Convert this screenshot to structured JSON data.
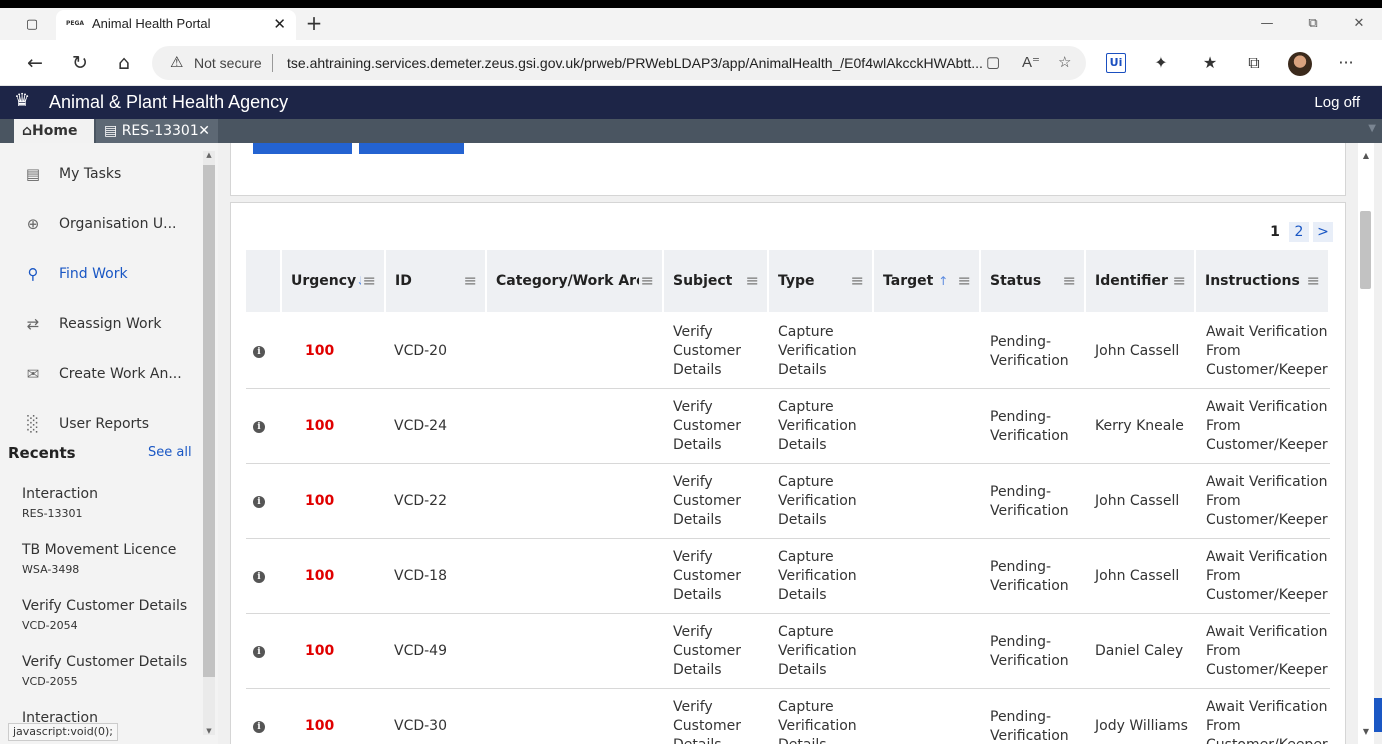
{
  "browser": {
    "tab_title": "Animal Health Portal",
    "tab_favicon": "PEGA",
    "security_label": "Not secure",
    "url": "tse.ahtraining.services.demeter.zeus.gsi.gov.uk/prweb/PRWebLDAP3/app/AnimalHealth_/E0f4wlAkcckHWAbtt...",
    "ext_label": "Ui"
  },
  "app": {
    "agency_name": "Animal & Plant Health Agency",
    "logoff_label": "Log off"
  },
  "work_tabs": {
    "home_label": "Home",
    "case_label": "RES-13301"
  },
  "sidebar": {
    "items": [
      {
        "label": "My Tasks",
        "icon": "clipboard-icon"
      },
      {
        "label": "Organisation U...",
        "icon": "globe-icon"
      },
      {
        "label": "Find Work",
        "icon": "search-icon"
      },
      {
        "label": "Reassign Work",
        "icon": "reassign-arrows-icon"
      },
      {
        "label": "Create Work An...",
        "icon": "briefcase-icon"
      },
      {
        "label": "User Reports",
        "icon": "bar-chart-icon"
      }
    ],
    "recents_title": "Recents",
    "see_all_label": "See all",
    "recents": [
      {
        "title": "Interaction",
        "id": "RES-13301"
      },
      {
        "title": "TB Movement Licence",
        "id": "WSA-3498"
      },
      {
        "title": "Verify Customer Details",
        "id": "VCD-2054"
      },
      {
        "title": "Verify Customer Details",
        "id": "VCD-2055"
      },
      {
        "title": "Interaction",
        "id": ""
      }
    ]
  },
  "status_bar_text": "javascript:void(0);",
  "pager": {
    "current": "1",
    "next_page": "2",
    "next_arrow": ">"
  },
  "table": {
    "headers": {
      "urgency": "Urgency",
      "id": "ID",
      "category": "Category/Work Area",
      "subject": "Subject",
      "type": "Type",
      "target": "Target",
      "status": "Status",
      "identifier": "Identifier",
      "instructions": "Instructions"
    },
    "rows": [
      {
        "urgency": "100",
        "id": "VCD-20",
        "subject": "Verify Customer Details",
        "type": "Capture Verification Details",
        "status": "Pending-Verification",
        "identifier": "John Cassell",
        "instructions": "Await Verification From Customer/Keeper"
      },
      {
        "urgency": "100",
        "id": "VCD-24",
        "subject": "Verify Customer Details",
        "type": "Capture Verification Details",
        "status": "Pending-Verification",
        "identifier": "Kerry Kneale",
        "instructions": "Await Verification From Customer/Keeper"
      },
      {
        "urgency": "100",
        "id": "VCD-22",
        "subject": "Verify Customer Details",
        "type": "Capture Verification Details",
        "status": "Pending-Verification",
        "identifier": "John Cassell",
        "instructions": "Await Verification From Customer/Keeper"
      },
      {
        "urgency": "100",
        "id": "VCD-18",
        "subject": "Verify Customer Details",
        "type": "Capture Verification Details",
        "status": "Pending-Verification",
        "identifier": "John Cassell",
        "instructions": "Await Verification From Customer/Keeper"
      },
      {
        "urgency": "100",
        "id": "VCD-49",
        "subject": "Verify Customer Details",
        "type": "Capture Verification Details",
        "status": "Pending-Verification",
        "identifier": "Daniel Caley",
        "instructions": "Await Verification From Customer/Keeper"
      },
      {
        "urgency": "100",
        "id": "VCD-30",
        "subject": "Verify Customer Details",
        "type": "Capture Verification Details",
        "status": "Pending-Verification",
        "identifier": "Jody Williams",
        "instructions": "Await Verification From Customer/Keeper"
      }
    ]
  },
  "colors": {
    "header_bg": "#1d2547",
    "accent": "#2463d1",
    "urgency": "#e00000"
  }
}
